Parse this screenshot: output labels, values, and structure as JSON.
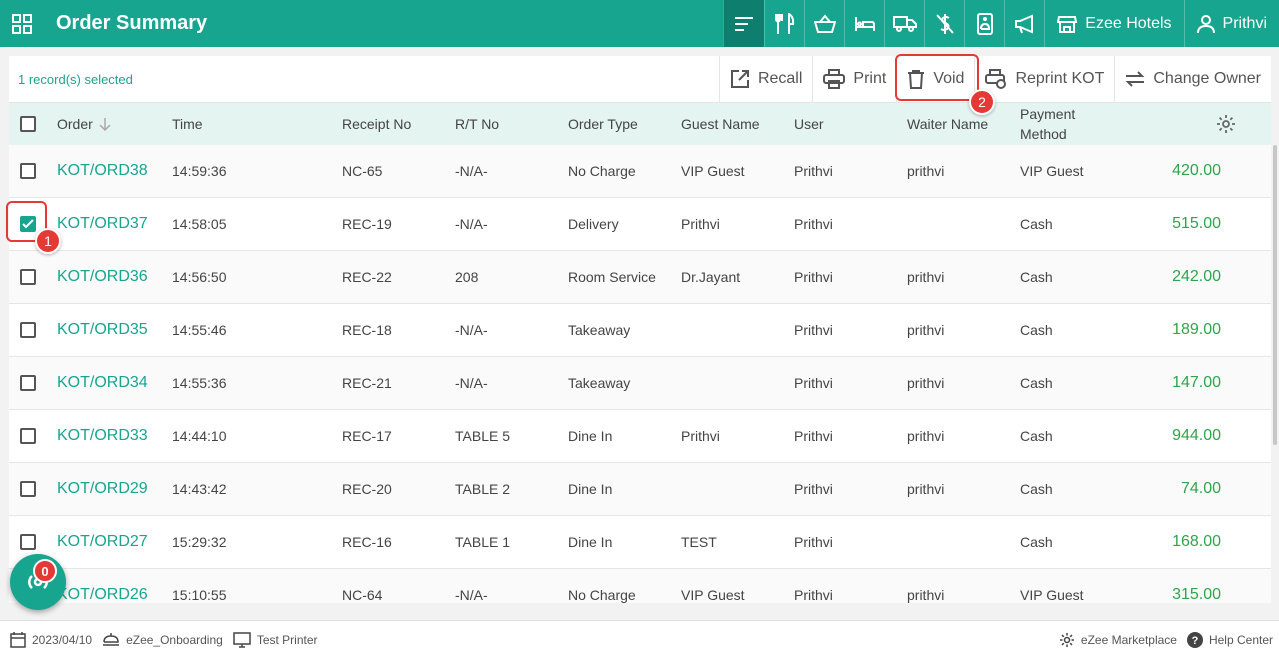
{
  "header": {
    "title": "Order Summary",
    "hotel_label": "Ezee Hotels",
    "user_label": "Prithvi"
  },
  "toolbar": {
    "selected_text": "1 record(s) selected",
    "recall": "Recall",
    "print": "Print",
    "void": "Void",
    "reprint_kot": "Reprint KOT",
    "change_owner": "Change Owner"
  },
  "table": {
    "columns": {
      "order": "Order",
      "time": "Time",
      "receipt": "Receipt No",
      "rt": "R/T No",
      "order_type": "Order Type",
      "guest": "Guest Name",
      "user": "User",
      "waiter": "Waiter Name",
      "payment": "Payment Method"
    },
    "rows": [
      {
        "order": "KOT/ORD38",
        "time": "14:59:36",
        "receipt": "NC-65",
        "rt": "-N/A-",
        "type": "No Charge",
        "guest": "VIP Guest",
        "user": "Prithvi",
        "waiter": "prithvi",
        "payment": "VIP Guest",
        "amount": "420.00",
        "checked": false
      },
      {
        "order": "KOT/ORD37",
        "time": "14:58:05",
        "receipt": "REC-19",
        "rt": "-N/A-",
        "type": "Delivery",
        "guest": "Prithvi",
        "user": "Prithvi",
        "waiter": "",
        "payment": "Cash",
        "amount": "515.00",
        "checked": true
      },
      {
        "order": "KOT/ORD36",
        "time": "14:56:50",
        "receipt": "REC-22",
        "rt": "208",
        "type": "Room Service",
        "guest": "Dr.Jayant",
        "user": "Prithvi",
        "waiter": "prithvi",
        "payment": "Cash",
        "amount": "242.00",
        "checked": false
      },
      {
        "order": "KOT/ORD35",
        "time": "14:55:46",
        "receipt": "REC-18",
        "rt": "-N/A-",
        "type": "Takeaway",
        "guest": "",
        "user": "Prithvi",
        "waiter": "prithvi",
        "payment": "Cash",
        "amount": "189.00",
        "checked": false
      },
      {
        "order": "KOT/ORD34",
        "time": "14:55:36",
        "receipt": "REC-21",
        "rt": "-N/A-",
        "type": "Takeaway",
        "guest": "",
        "user": "Prithvi",
        "waiter": "prithvi",
        "payment": "Cash",
        "amount": "147.00",
        "checked": false
      },
      {
        "order": "KOT/ORD33",
        "time": "14:44:10",
        "receipt": "REC-17",
        "rt": "TABLE 5",
        "type": "Dine In",
        "guest": "Prithvi",
        "user": "Prithvi",
        "waiter": "prithvi",
        "payment": "Cash",
        "amount": "944.00",
        "checked": false
      },
      {
        "order": "KOT/ORD29",
        "time": "14:43:42",
        "receipt": "REC-20",
        "rt": "TABLE 2",
        "type": "Dine In",
        "guest": "",
        "user": "Prithvi",
        "waiter": "prithvi",
        "payment": "Cash",
        "amount": "74.00",
        "checked": false
      },
      {
        "order": "KOT/ORD27",
        "time": "15:29:32",
        "receipt": "REC-16",
        "rt": "TABLE 1",
        "type": "Dine In",
        "guest": "TEST",
        "user": "Prithvi",
        "waiter": "",
        "payment": "Cash",
        "amount": "168.00",
        "checked": false
      },
      {
        "order": "KOT/ORD26",
        "time": "15:10:55",
        "receipt": "NC-64",
        "rt": "-N/A-",
        "type": "No Charge",
        "guest": "VIP Guest",
        "user": "Prithvi",
        "waiter": "prithvi",
        "payment": "VIP Guest",
        "amount": "315.00",
        "checked": false
      }
    ]
  },
  "annotations": {
    "step1": "1",
    "step2": "2"
  },
  "fab": {
    "badge_count": "0"
  },
  "statusbar": {
    "date": "2023/04/10",
    "outlet": "eZee_Onboarding",
    "printer": "Test Printer",
    "marketplace": "eZee Marketplace",
    "help": "Help Center"
  },
  "colors": {
    "brand": "#18a58f",
    "brand_dark": "#0e7f6e",
    "amount": "#2da54a",
    "highlight": "#e53935"
  }
}
